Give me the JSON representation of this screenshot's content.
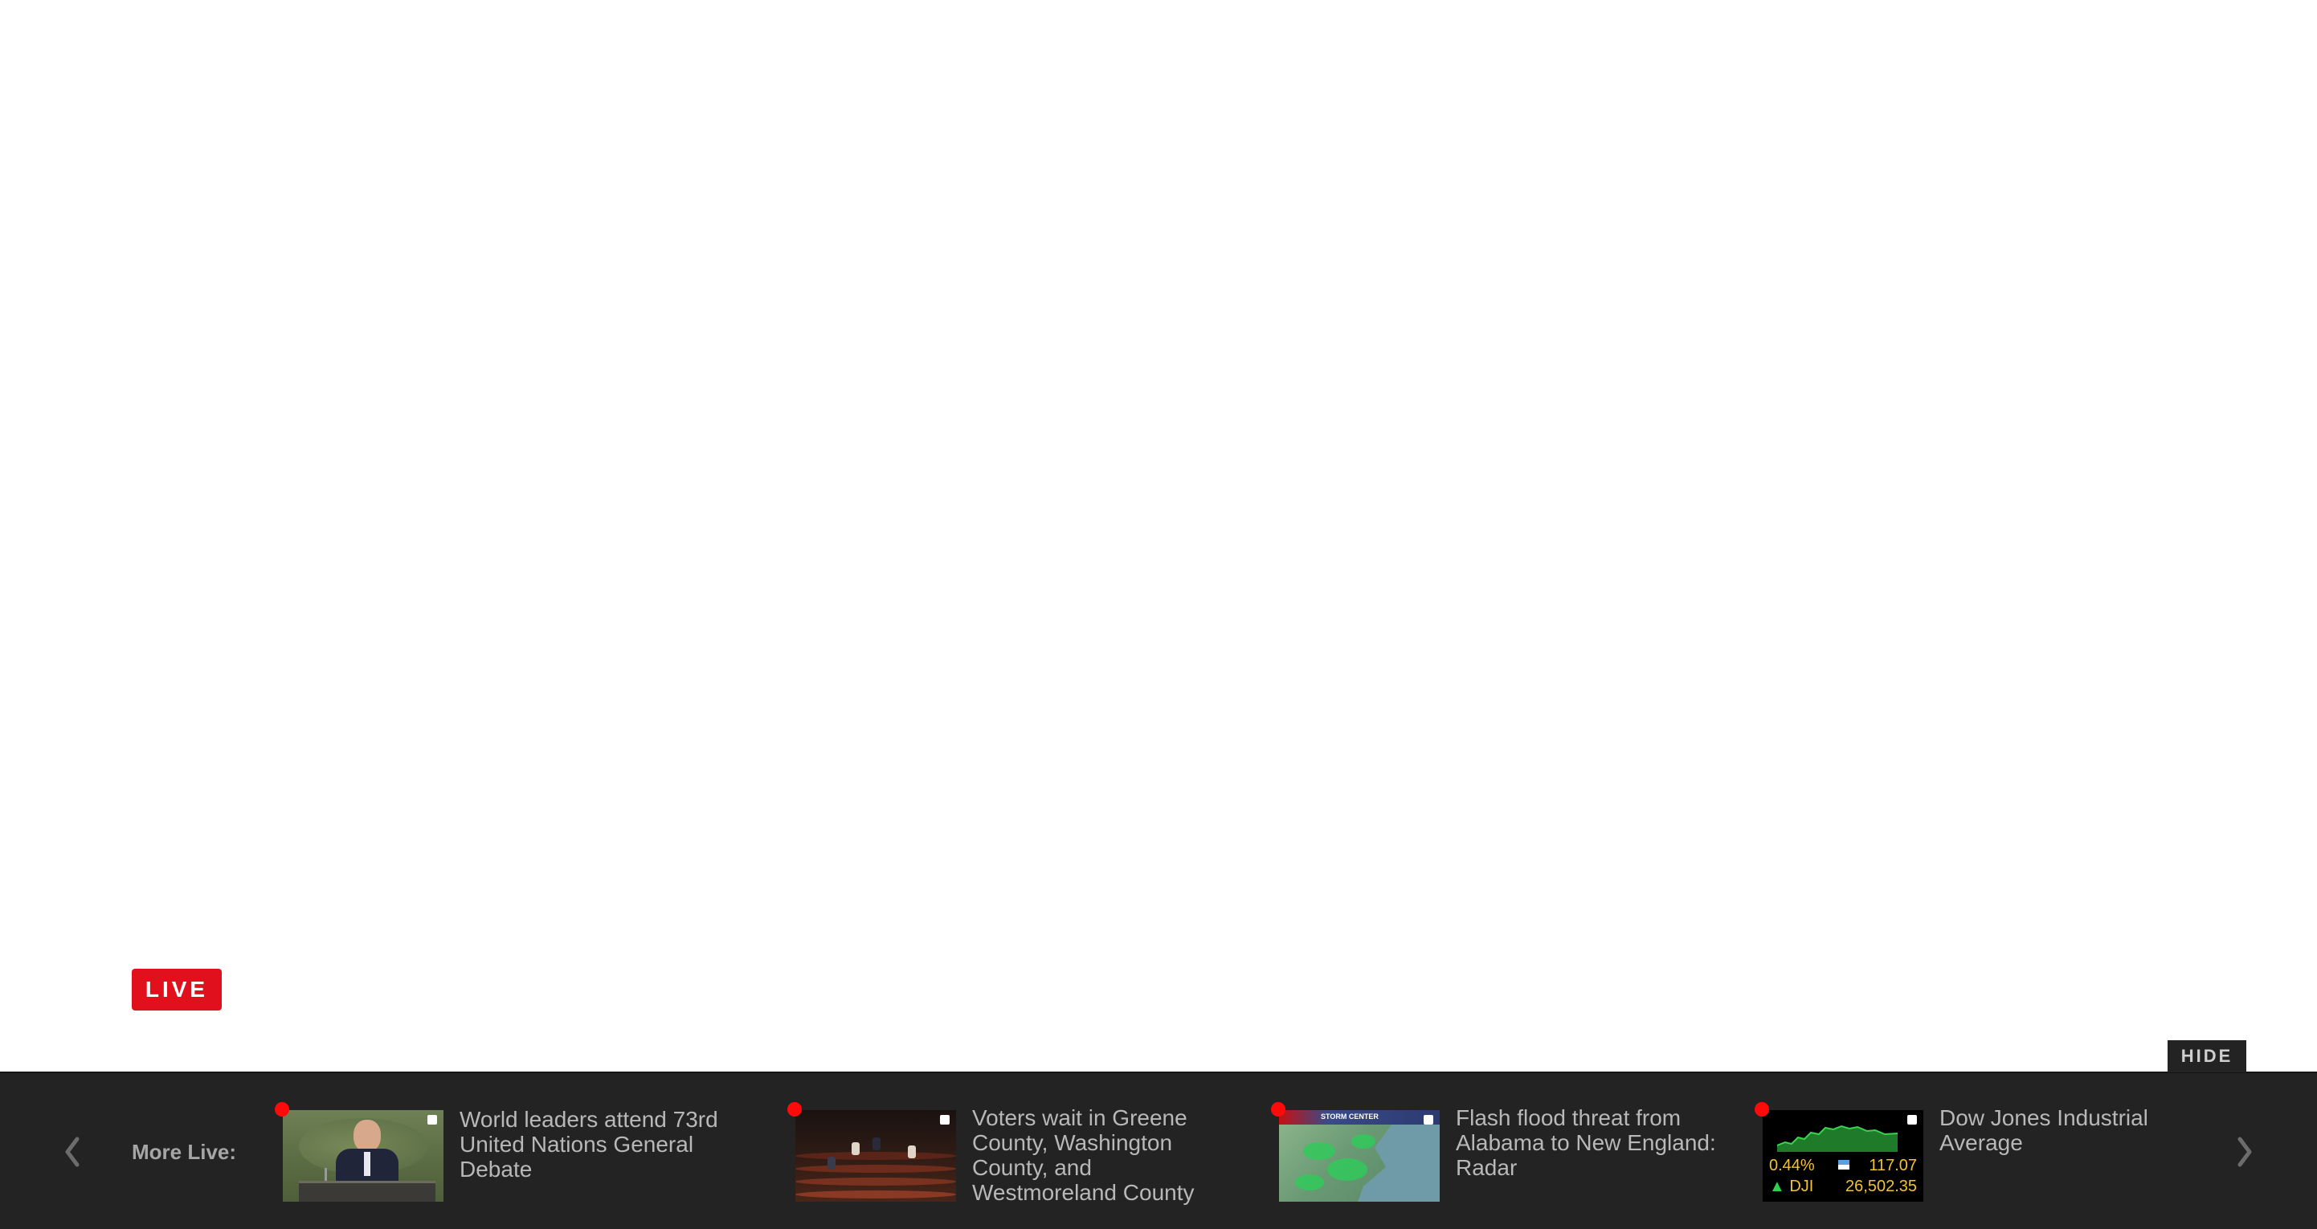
{
  "player": {
    "live_badge": "LIVE",
    "hide_label": "HIDE"
  },
  "more_live": {
    "label": "More Live:",
    "items": [
      {
        "title": "World leaders attend 73rd United Nations General Debate"
      },
      {
        "title": "Voters wait in Greene County, Washington County, and Westmoreland County"
      },
      {
        "title": "Flash flood threat from Alabama to New England: Radar",
        "thumb_header": "STORM CENTER"
      },
      {
        "title": "Dow Jones Industrial Average",
        "thumb_percent": "0.44%",
        "thumb_change": "117.07",
        "thumb_ticker": "DJI",
        "thumb_value": "26,502.35"
      }
    ]
  },
  "colors": {
    "live_red": "#e0101c",
    "bar_bg": "#232323",
    "ticker_yellow": "#f2c230",
    "up_green": "#2fd04a"
  },
  "icons": {
    "prev": "chevron-left-icon",
    "next": "chevron-right-icon",
    "live_indicator": "live-dot-icon"
  }
}
